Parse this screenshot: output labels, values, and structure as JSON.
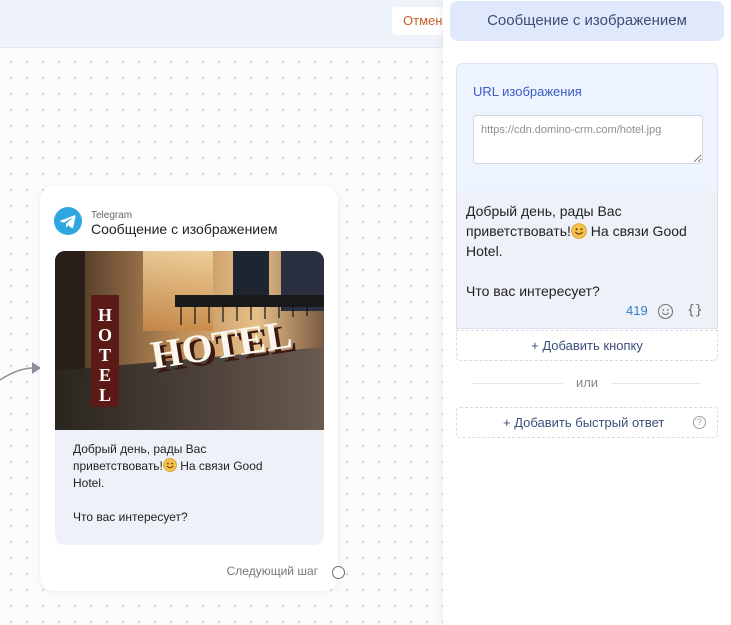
{
  "toolbar": {
    "cancel_label": "Отмен"
  },
  "node": {
    "channel": "Telegram",
    "title": "Сообщение с изображением",
    "message_lines": [
      "Добрый день, рады Вас",
      "приветствовать!",
      " На связи Good",
      "Hotel.",
      "Что вас интересует?"
    ],
    "next_step_label": "Следующий шаг",
    "image_sign": "HOTEL",
    "image_sign_vertical": "HOTEL"
  },
  "panel": {
    "header": "Сообщение с изображением",
    "image_url_label": "URL изображения",
    "image_url_placeholder": "https://cdn.domino-crm.com/hotel.jpg",
    "message_lines": [
      "Добрый день, рады Вас",
      "приветствовать!",
      " На связи Good",
      "Hotel.",
      "Что вас интересует?"
    ],
    "char_count": "419",
    "vars_label": "{}",
    "add_button_label": "+ Добавить кнопку",
    "or_label": "или",
    "quick_reply_label": "+ Добавить быстрый ответ",
    "help_label": "?"
  },
  "colors": {
    "accent": "#3b5bc4",
    "counter": "#2f7fd6",
    "cancel": "#c4602a",
    "telegram": "#2ea6e0",
    "header_bg": "#dfe9fb"
  },
  "icons": {
    "telegram": "telegram-icon",
    "emoji": "smile-emoji-icon",
    "smile_button": "smile-icon",
    "help": "question-icon"
  }
}
